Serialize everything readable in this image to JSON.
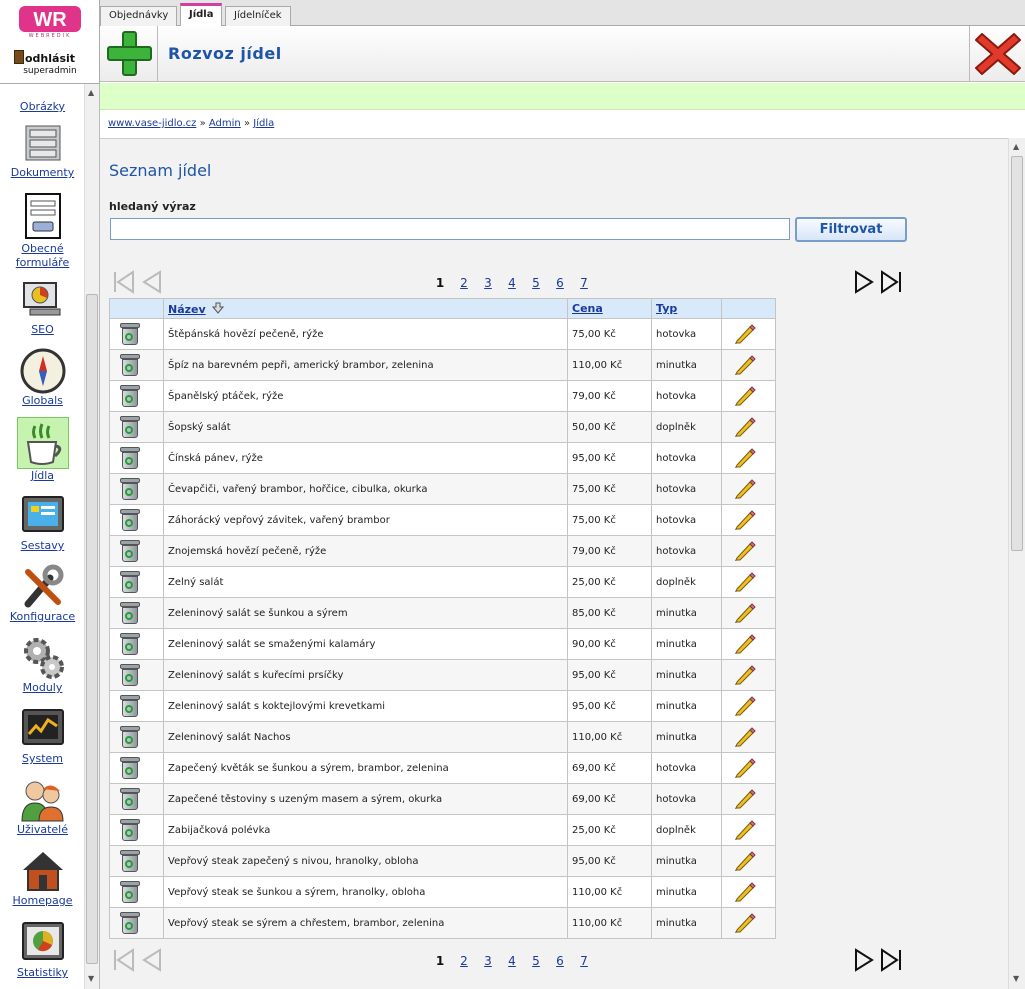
{
  "brand": {
    "logo_text": "WR",
    "logo_sub": "WEBREDIK"
  },
  "account": {
    "logout_label": "odhlásit",
    "role": "superadmin"
  },
  "tabs": [
    {
      "label": "Objednávky",
      "active": false
    },
    {
      "label": "Jídla",
      "active": true
    },
    {
      "label": "Jídelníček",
      "active": false
    }
  ],
  "header": {
    "title": "Rozvoz jídel"
  },
  "breadcrumb": {
    "home": "www.vase-jidlo.cz",
    "sep1": "»",
    "admin": "Admin",
    "sep2": "»",
    "current": "Jídla"
  },
  "sidebar": {
    "items": [
      {
        "label": "Obrázky",
        "icon": "images-icon"
      },
      {
        "label": "Dokumenty",
        "icon": "documents-icon"
      },
      {
        "label": "Obecné formuláře",
        "icon": "forms-icon"
      },
      {
        "label": "SEO",
        "icon": "seo-icon"
      },
      {
        "label": "Globals",
        "icon": "compass-icon"
      },
      {
        "label": "Jídla",
        "icon": "coffee-cup-icon",
        "active": true
      },
      {
        "label": "Sestavy",
        "icon": "screen-icon"
      },
      {
        "label": "Konfigurace",
        "icon": "tools-icon"
      },
      {
        "label": "Moduly",
        "icon": "gears-icon"
      },
      {
        "label": "System",
        "icon": "monitor-icon"
      },
      {
        "label": "Uživatelé",
        "icon": "users-icon"
      },
      {
        "label": "Homepage",
        "icon": "house-icon"
      },
      {
        "label": "Statistiky",
        "icon": "pie-chart-icon"
      }
    ]
  },
  "main": {
    "heading": "Seznam jídel",
    "search_label": "hledaný výraz",
    "search_value": "",
    "filter_button": "Filtrovat",
    "current_page": "1",
    "pages": [
      "2",
      "3",
      "4",
      "5",
      "6",
      "7"
    ],
    "columns": {
      "name": "Název",
      "price": "Cena",
      "type": "Typ"
    },
    "rows": [
      {
        "name": "Štěpánská hovězí pečeně, rýže",
        "price": "75,00 Kč",
        "type": "hotovka"
      },
      {
        "name": "Špíz na barevném pepři, americký brambor, zelenina",
        "price": "110,00 Kč",
        "type": "minutka"
      },
      {
        "name": "Španělský ptáček, rýže",
        "price": "79,00 Kč",
        "type": "hotovka"
      },
      {
        "name": "Šopský salát",
        "price": "50,00 Kč",
        "type": "doplněk"
      },
      {
        "name": "Čínská pánev, rýže",
        "price": "95,00 Kč",
        "type": "hotovka"
      },
      {
        "name": "Čevapčiči, vařený brambor, hořčice, cibulka, okurka",
        "price": "75,00 Kč",
        "type": "hotovka"
      },
      {
        "name": "Záhorácký vepřový závitek, vařený brambor",
        "price": "75,00 Kč",
        "type": "hotovka"
      },
      {
        "name": "Znojemská hovězí pečeně, rýže",
        "price": "79,00 Kč",
        "type": "hotovka"
      },
      {
        "name": "Zelný salát",
        "price": "25,00 Kč",
        "type": "doplněk"
      },
      {
        "name": "Zeleninový salát se šunkou a sýrem",
        "price": "85,00 Kč",
        "type": "minutka"
      },
      {
        "name": "Zeleninový salát se smaženými kalamáry",
        "price": "90,00 Kč",
        "type": "minutka"
      },
      {
        "name": "Zeleninový salát s kuřecími prsíčky",
        "price": "95,00 Kč",
        "type": "minutka"
      },
      {
        "name": "Zeleninový salát s koktejlovými krevetkami",
        "price": "95,00 Kč",
        "type": "minutka"
      },
      {
        "name": "Zeleninový salát Nachos",
        "price": "110,00 Kč",
        "type": "minutka"
      },
      {
        "name": "Zapečený květák se šunkou a sýrem, brambor, zelenina",
        "price": "69,00 Kč",
        "type": "hotovka"
      },
      {
        "name": "Zapečené těstoviny s uzeným masem a sýrem, okurka",
        "price": "69,00 Kč",
        "type": "hotovka"
      },
      {
        "name": "Zabijačková polévka",
        "price": "25,00 Kč",
        "type": "doplněk"
      },
      {
        "name": "Vepřový steak zapečený s nivou, hranolky, obloha",
        "price": "95,00 Kč",
        "type": "minutka"
      },
      {
        "name": "Vepřový steak se šunkou a sýrem, hranolky, obloha",
        "price": "110,00 Kč",
        "type": "minutka"
      },
      {
        "name": "Vepřový steak se sýrem a chřestem, brambor, zelenina",
        "price": "110,00 Kč",
        "type": "minutka"
      }
    ]
  },
  "colors": {
    "accent": "#1e55a8",
    "notice": "#ddffc8",
    "tab_active": "#d23da0",
    "header_row": "#d8e9f9"
  }
}
